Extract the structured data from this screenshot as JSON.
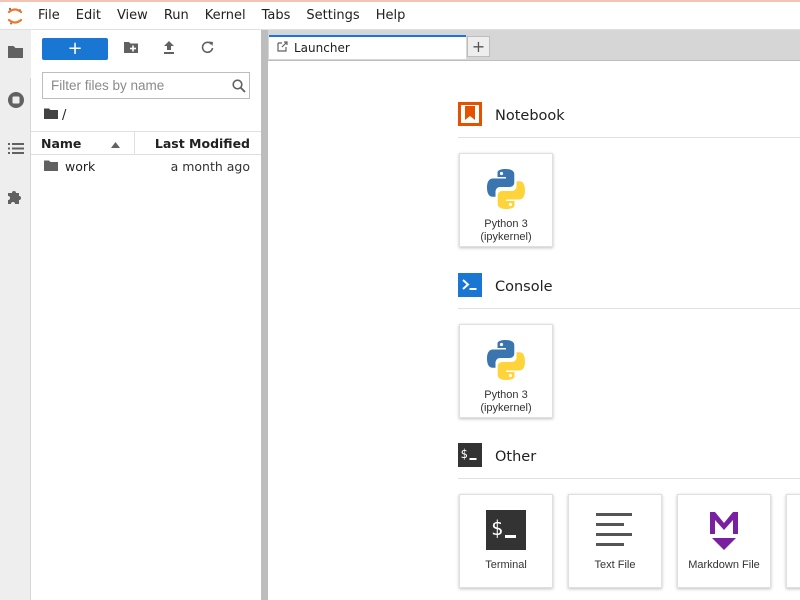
{
  "menubar": {
    "items": [
      "File",
      "Edit",
      "View",
      "Run",
      "Kernel",
      "Tabs",
      "Settings",
      "Help"
    ]
  },
  "activity_bar": {
    "icons": [
      "folder-icon",
      "running-icon",
      "toc-icon",
      "extension-icon"
    ]
  },
  "filebrowser": {
    "new_label": "+",
    "filter_placeholder": "Filter files by name",
    "breadcrumb": "/",
    "columns": {
      "name": "Name",
      "modified": "Last Modified"
    },
    "rows": [
      {
        "name": "work",
        "modified": "a month ago",
        "type": "folder"
      }
    ]
  },
  "tabs": [
    {
      "label": "Launcher"
    }
  ],
  "add_tab_label": "+",
  "launcher": {
    "sections": [
      {
        "title": "Notebook",
        "cards": [
          {
            "label": "Python 3 (ipykernel)"
          }
        ]
      },
      {
        "title": "Console",
        "cards": [
          {
            "label": "Python 3 (ipykernel)"
          }
        ]
      },
      {
        "title": "Other",
        "cards": [
          {
            "label": "Terminal"
          },
          {
            "label": "Text File"
          },
          {
            "label": "Markdown File"
          }
        ]
      }
    ]
  },
  "colors": {
    "accent": "#1976d2",
    "notebook_icon": "#e65100",
    "console_icon": "#1976d2",
    "markdown_icon": "#7b1fa2",
    "python_blue": "#3a75b0",
    "python_yellow": "#ffd43b"
  }
}
